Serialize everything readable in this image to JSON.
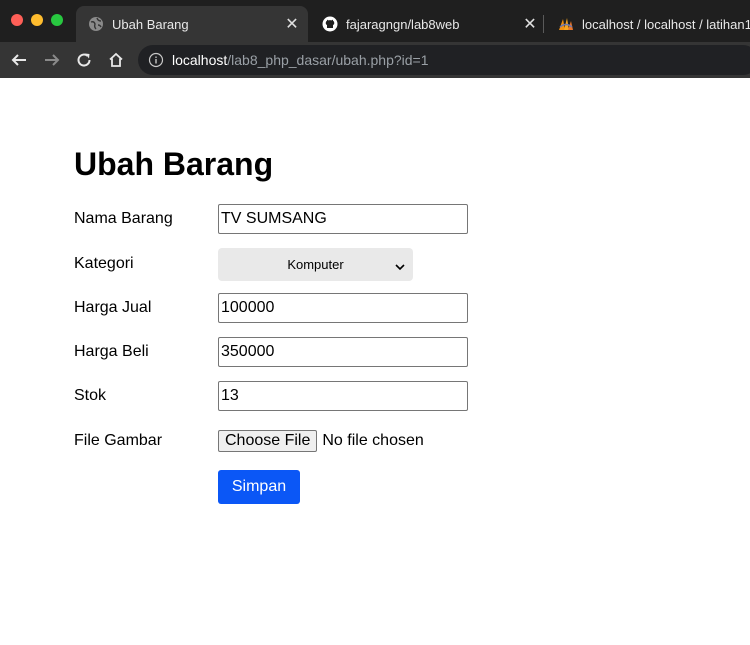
{
  "browser": {
    "tabs": [
      {
        "title": "Ubah Barang",
        "favicon": "globe-icon",
        "active": true
      },
      {
        "title": "fajaragngn/lab8web",
        "favicon": "github-icon",
        "active": false
      },
      {
        "title": "localhost / localhost / latihan1",
        "favicon": "phpmyadmin-icon",
        "active": false
      }
    ],
    "url": {
      "host": "localhost",
      "path": "/lab8_php_dasar/ubah.php?id=1"
    }
  },
  "page": {
    "title": "Ubah Barang"
  },
  "form": {
    "nama_barang": {
      "label": "Nama Barang",
      "value": "TV SUMSANG"
    },
    "kategori": {
      "label": "Kategori",
      "value": "Komputer"
    },
    "harga_jual": {
      "label": "Harga Jual",
      "value": "100000"
    },
    "harga_beli": {
      "label": "Harga Beli",
      "value": "350000"
    },
    "stok": {
      "label": "Stok",
      "value": "13"
    },
    "file_gambar": {
      "label": "File Gambar",
      "button": "Choose File",
      "status": "No file chosen"
    },
    "submit": {
      "label": "Simpan"
    }
  },
  "colors": {
    "submit_bg": "#0b57f6",
    "chrome_dark": "#1f1f1f",
    "chrome_toolbar": "#353535"
  }
}
